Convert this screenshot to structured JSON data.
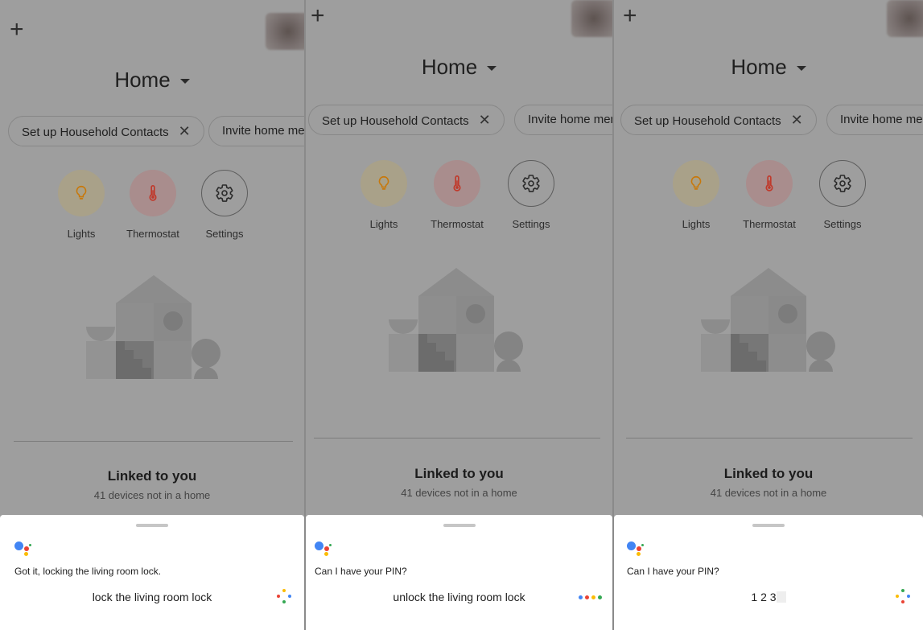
{
  "panels": [
    {
      "home_title": "Home",
      "chips": [
        {
          "label": "Set up Household Contacts",
          "dismiss": "✕"
        },
        {
          "label": "Invite home mem"
        }
      ],
      "favorites": [
        {
          "label": "Lights",
          "icon": "lightbulb-icon"
        },
        {
          "label": "Thermostat",
          "icon": "thermometer-icon"
        },
        {
          "label": "Settings",
          "icon": "gear-icon"
        }
      ],
      "linked_title": "Linked to you",
      "linked_subtitle": "41 devices not in a home",
      "assistant": {
        "reply": "Got it, locking the living room lock.",
        "query": "lock the living room lock",
        "indicator": "sparkle"
      }
    },
    {
      "home_title": "Home",
      "chips": [
        {
          "label": "Set up Household Contacts",
          "dismiss": "✕"
        },
        {
          "label": "Invite home mem"
        }
      ],
      "favorites": [
        {
          "label": "Lights",
          "icon": "lightbulb-icon"
        },
        {
          "label": "Thermostat",
          "icon": "thermometer-icon"
        },
        {
          "label": "Settings",
          "icon": "gear-icon"
        }
      ],
      "linked_title": "Linked to you",
      "linked_subtitle": "41 devices not in a home",
      "assistant": {
        "reply": "Can I have your PIN?",
        "query": "unlock the living room lock",
        "indicator": "listening-dots"
      }
    },
    {
      "home_title": "Home",
      "chips": [
        {
          "label": "Set up Household Contacts",
          "dismiss": "✕"
        },
        {
          "label": "Invite home me"
        }
      ],
      "favorites": [
        {
          "label": "Lights",
          "icon": "lightbulb-icon"
        },
        {
          "label": "Thermostat",
          "icon": "thermometer-icon"
        },
        {
          "label": "Settings",
          "icon": "gear-icon"
        }
      ],
      "linked_title": "Linked to you",
      "linked_subtitle": "41 devices not in a home",
      "assistant": {
        "reply": "Can I have your PIN?",
        "query": "1 2 3",
        "indicator": "sparkle"
      }
    }
  ],
  "common": {
    "add_glyph": "+"
  },
  "colors": {
    "google_blue": "#4285f4",
    "google_red": "#ea4335",
    "google_yellow": "#fbbc05",
    "google_green": "#34a853",
    "lights_icon": "#c8780a",
    "thermostat_icon": "#c0392b"
  }
}
